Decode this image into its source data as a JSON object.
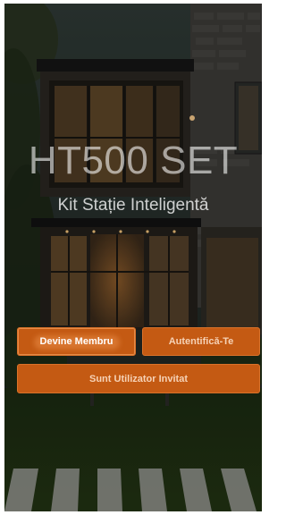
{
  "app": {
    "title": "HT500 SET",
    "subtitle": "Kit Stație Inteligentă"
  },
  "actions": {
    "become_member": "Devine Membru",
    "sign_in": "Autentifică-Te",
    "guest_user": "Sunt Utilizator Invitat"
  },
  "colors": {
    "accent": "#c45a13",
    "accent_border": "#d9722a",
    "button_text": "#f6d2b6"
  },
  "background": {
    "image": "modern-house-night-photo"
  }
}
